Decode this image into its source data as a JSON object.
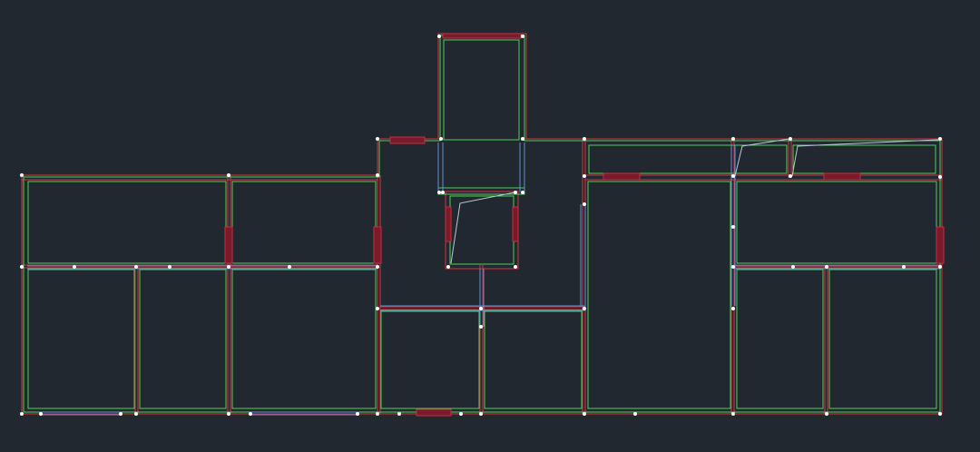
{
  "drawing": {
    "colors": {
      "background": "#212830",
      "wall_green": "#4fcf57",
      "wall_red": "#d7343f",
      "beam_blue": "#5f8fd6",
      "opening_fill": "#7a1a2a",
      "opening_stroke": "#c62f40",
      "vertex": "#ffffff",
      "stair_line": "#b9c7d8"
    }
  }
}
